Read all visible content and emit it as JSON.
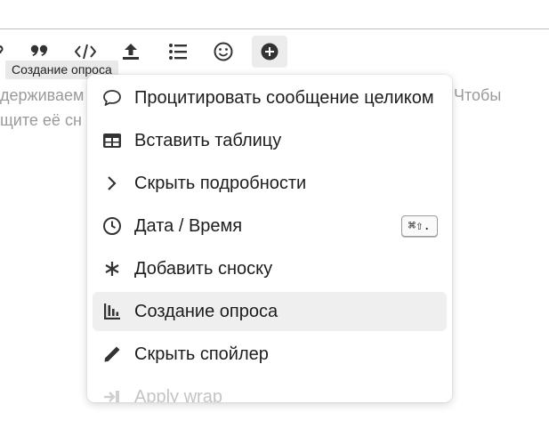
{
  "toolbar": {
    "buttons": [
      {
        "icon": "question-icon"
      },
      {
        "icon": "quote-icon"
      },
      {
        "icon": "code-icon"
      },
      {
        "icon": "upload-icon"
      },
      {
        "icon": "bullet-list-icon"
      },
      {
        "icon": "emoji-icon"
      },
      {
        "icon": "plus-circle-icon",
        "active": true
      }
    ]
  },
  "tooltip": {
    "text": "Создание опроса"
  },
  "composer": {
    "line1_left": "держиваем",
    "line1_right": "Чтобы",
    "line2_left": "щите её сн"
  },
  "menu": {
    "items": [
      {
        "label": "Процитировать сообщение целиком",
        "icon": "speech-bubble-icon"
      },
      {
        "label": "Вставить таблицу",
        "icon": "table-icon"
      },
      {
        "label": "Скрыть подробности",
        "icon": "chevron-right-icon"
      },
      {
        "label": "Дата / Время",
        "icon": "clock-icon",
        "shortcut": "⌘⇧."
      },
      {
        "label": "Добавить сноску",
        "icon": "asterisk-icon"
      },
      {
        "label": "Создание опроса",
        "icon": "poll-chart-icon",
        "highlighted": true
      },
      {
        "label": "Скрыть спойлер",
        "icon": "pencil-icon"
      },
      {
        "label": "Apply wrap",
        "icon": "wrap-arrow-icon"
      }
    ]
  },
  "colors": {
    "menu_highlight": "#efefef",
    "active_button": "#ececec",
    "placeholder_text": "#9a9a9a"
  }
}
